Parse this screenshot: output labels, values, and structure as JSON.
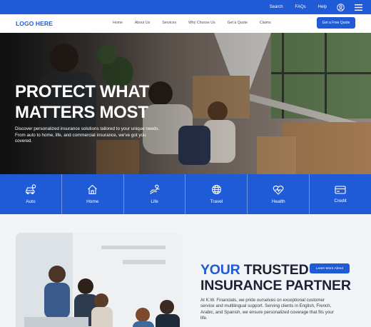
{
  "topbar": {
    "links": [
      {
        "label": "Search"
      },
      {
        "label": "FAQs"
      },
      {
        "label": "Help"
      }
    ]
  },
  "header": {
    "logo": "LOGO HERE",
    "nav": [
      {
        "label": "Home"
      },
      {
        "label": "About Us"
      },
      {
        "label": "Services"
      },
      {
        "label": "Why Choose Us"
      },
      {
        "label": "Get a Quote"
      },
      {
        "label": "Claims"
      }
    ],
    "cta_label": "Get a Free Quote"
  },
  "hero": {
    "title_line1": "PROTECT WHAT",
    "title_line2": "MATTERS MOST",
    "description": "Discover personalized insurance solutions tailored to your unique needs. From auto to home, life, and commercial insurance, we've got you covered."
  },
  "services": [
    {
      "label": "Auto",
      "icon": "car-icon"
    },
    {
      "label": "Home",
      "icon": "home-icon"
    },
    {
      "label": "Life",
      "icon": "life-hand-icon"
    },
    {
      "label": "Travel",
      "icon": "globe-icon"
    },
    {
      "label": "Health",
      "icon": "heart-pulse-icon"
    },
    {
      "label": "Credit",
      "icon": "credit-card-icon"
    }
  ],
  "about": {
    "heading_blue": "YOUR",
    "heading_rest_1": " TRUSTED",
    "heading_line2": "INSURANCE PARTNER",
    "learn_more": "Learn More About",
    "text": "At K.W. Financials, we pride ourselves on exceptional customer service and multilingual support. Serving clients in English, French, Arabic, and Spanish, we ensure personalized coverage that fits your life."
  },
  "colors": {
    "primary": "#1f5ad7",
    "dark_text": "#1b2233"
  }
}
